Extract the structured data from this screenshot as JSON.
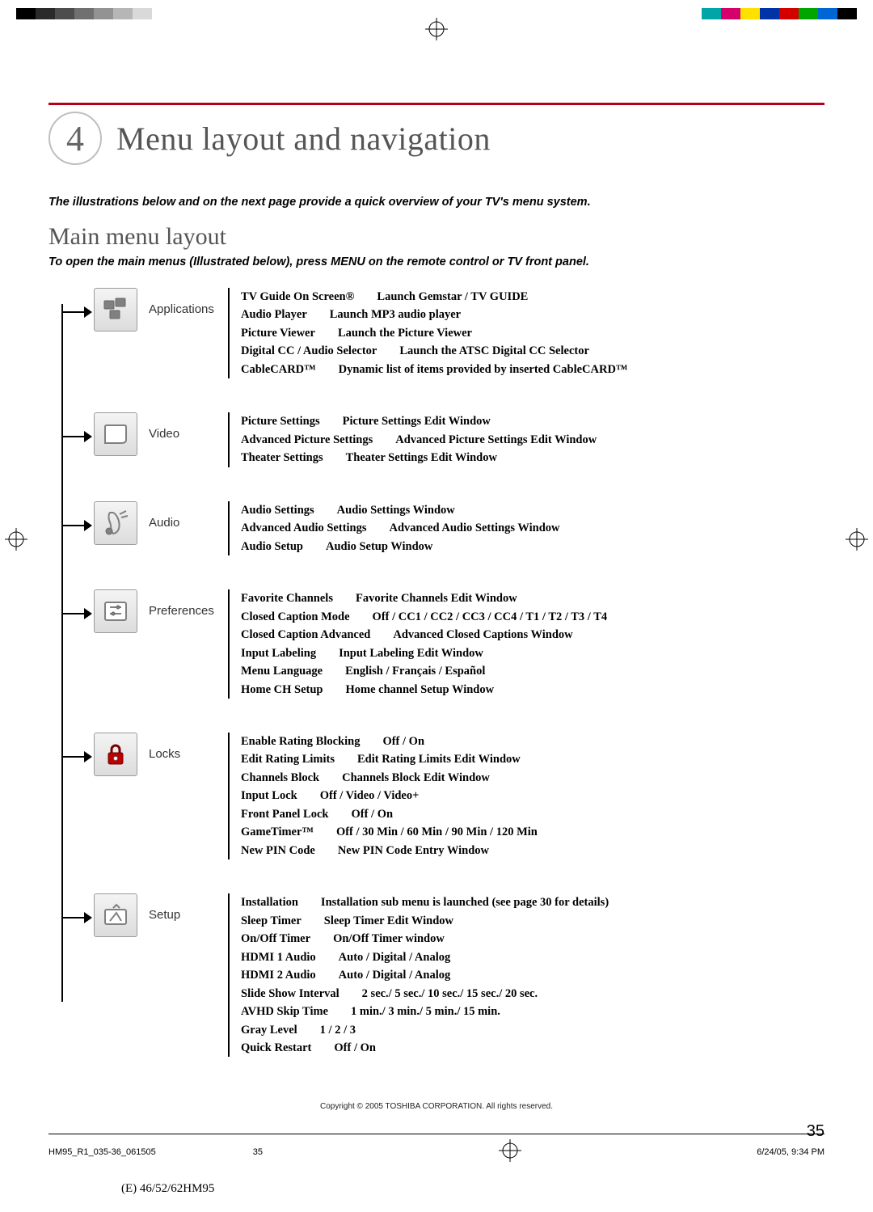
{
  "chapter": {
    "number": "4",
    "title": "Menu layout and navigation"
  },
  "intro": "The illustrations below and on the next page provide a quick overview of your TV's menu system.",
  "section": {
    "title": "Main menu layout",
    "note": "To open the main menus (Illustrated below), press MENU on the remote control or TV front panel."
  },
  "categories": [
    {
      "label": "Applications",
      "icon": "applications-icon",
      "items": [
        {
          "k": "TV Guide On Screen®",
          "v": "Launch Gemstar / TV GUIDE"
        },
        {
          "k": "Audio Player",
          "v": "Launch MP3 audio player"
        },
        {
          "k": "Picture Viewer",
          "v": "Launch the Picture Viewer"
        },
        {
          "k": "Digital CC / Audio Selector",
          "v": "Launch the ATSC Digital CC Selector"
        },
        {
          "k": "CableCARD™",
          "v": "Dynamic list of items provided by inserted CableCARD™"
        }
      ]
    },
    {
      "label": "Video",
      "icon": "video-icon",
      "items": [
        {
          "k": "Picture Settings",
          "v": "Picture Settings Edit Window"
        },
        {
          "k": "Advanced Picture Settings",
          "v": "Advanced Picture Settings Edit Window"
        },
        {
          "k": "Theater Settings",
          "v": "Theater Settings Edit Window"
        }
      ]
    },
    {
      "label": "Audio",
      "icon": "audio-icon",
      "items": [
        {
          "k": "Audio Settings",
          "v": "Audio Settings Window"
        },
        {
          "k": "Advanced Audio Settings",
          "v": "Advanced Audio Settings Window"
        },
        {
          "k": "Audio Setup",
          "v": "Audio Setup Window"
        }
      ]
    },
    {
      "label": "Preferences",
      "icon": "preferences-icon",
      "items": [
        {
          "k": "Favorite Channels",
          "v": "Favorite Channels Edit Window"
        },
        {
          "k": "Closed Caption Mode",
          "v": "Off / CC1 / CC2 / CC3 / CC4 / T1 / T2 / T3 / T4"
        },
        {
          "k": "Closed Caption Advanced",
          "v": "Advanced Closed Captions Window"
        },
        {
          "k": "Input Labeling",
          "v": "Input Labeling Edit Window"
        },
        {
          "k": "Menu Language",
          "v": "English / Français / Español"
        },
        {
          "k": "Home CH Setup",
          "v": "Home channel Setup Window"
        }
      ]
    },
    {
      "label": "Locks",
      "icon": "locks-icon",
      "items": [
        {
          "k": "Enable Rating Blocking",
          "v": "Off / On"
        },
        {
          "k": "Edit Rating Limits",
          "v": "Edit Rating Limits Edit Window"
        },
        {
          "k": "Channels Block",
          "v": "Channels Block Edit Window"
        },
        {
          "k": "Input Lock",
          "v": "Off / Video / Video+"
        },
        {
          "k": "Front Panel Lock",
          "v": "Off / On"
        },
        {
          "k": "GameTimer™",
          "v": "Off / 30 Min / 60 Min / 90 Min / 120 Min"
        },
        {
          "k": "New PIN Code",
          "v": "New PIN Code Entry Window"
        }
      ]
    },
    {
      "label": "Setup",
      "icon": "setup-icon",
      "items": [
        {
          "k": "Installation",
          "v": "Installation sub menu is launched (see page 30 for details)"
        },
        {
          "k": "Sleep Timer",
          "v": "Sleep Timer Edit Window"
        },
        {
          "k": "On/Off Timer",
          "v": "On/Off Timer window"
        },
        {
          "k": "HDMI 1 Audio",
          "v": "Auto / Digital / Analog"
        },
        {
          "k": "HDMI 2 Audio",
          "v": "Auto / Digital / Analog"
        },
        {
          "k": "Slide Show Interval",
          "v": "2 sec./ 5 sec./ 10 sec./ 15 sec./ 20 sec."
        },
        {
          "k": "AVHD Skip Time",
          "v": "1 min./ 3 min./ 5 min./ 15 min."
        },
        {
          "k": "Gray Level",
          "v": "1 / 2 / 3"
        },
        {
          "k": "Quick Restart",
          "v": "Off / On"
        }
      ]
    }
  ],
  "footer": {
    "copyright": "Copyright © 2005 TOSHIBA CORPORATION. All rights reserved.",
    "page_number": "35",
    "doc_id": "HM95_R1_035-36_061505",
    "sheet": "35",
    "timestamp": "6/24/05, 9:34 PM",
    "model_line": "(E) 46/52/62HM95"
  },
  "swatch_colors": [
    "#00a6a6",
    "#d4006b",
    "#ffe100",
    "#0033a6",
    "#d40000",
    "#00a600",
    "#0066d4",
    "#000000"
  ],
  "gray_steps": [
    "#000",
    "#2a2a2a",
    "#4d4d4d",
    "#707070",
    "#939393",
    "#b6b6b6",
    "#d9d9d9",
    "#ffffff"
  ]
}
